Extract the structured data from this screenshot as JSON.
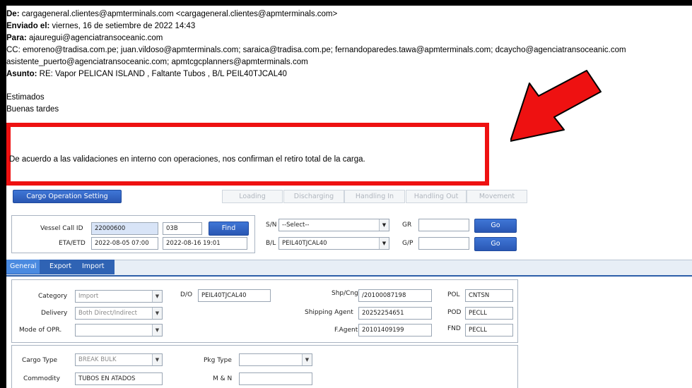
{
  "email": {
    "from_label": "De:",
    "from_value": " cargageneral.clientes@apmterminals.com <cargageneral.clientes@apmterminals.com>",
    "sent_label": "Enviado el:",
    "sent_value": " viernes, 16 de setiembre de 2022 14:43",
    "to_label": "Para:",
    "to_value": " ajauregui@agenciatransoceanic.com",
    "cc_label": "CC:",
    "cc_value": " emoreno@tradisa.com.pe; juan.vildoso@apmterminals.com; saraica@tradisa.com.pe; fernandoparedes.tawa@apmterminals.com; dcaycho@agenciatransoceanic.com",
    "cc_value2": "asistente_puerto@agenciatransoceanic.com; apmtcgcplanners@apmterminals.com",
    "subject_label": "Asunto:",
    "subject_value": " RE: Vapor PELICAN ISLAND , Faltante Tubos , B/L PEIL40TJCAL40",
    "greeting": "Estimados",
    "greeting2": "Buenas tardes",
    "body": "De acuerdo a las validaciones en interno con operaciones, nos confirman el retiro total de la carga."
  },
  "app": {
    "cargo_op_button": "Cargo Operation Setting",
    "loading": "Loading",
    "discharging": "Discharging",
    "handling_in": "Handling In",
    "handling_out": "Handling Out",
    "movement": "Movement",
    "vessel_call_id_label": "Vessel Call ID",
    "vessel_call_id": "22000600",
    "vessel_code": "03B",
    "find": "Find",
    "eta_etd_label": "ETA/ETD",
    "eta": "2022-08-05 07:00",
    "etd": "2022-08-16 19:01",
    "sn_label": "S/N",
    "sn_value": "--Select--",
    "bl_label": "B/L",
    "bl_value": "PEIL40TJCAL40",
    "gr_label": "GR",
    "gp_label": "G/P",
    "go": "Go",
    "tabs": [
      "General",
      "Export",
      "Import"
    ],
    "category_label": "Category",
    "category": "Import",
    "delivery_label": "Delivery",
    "delivery": "Both Direct/Indirect",
    "mode_label": "Mode of OPR.",
    "do_label": "D/O",
    "do_value": "PEIL40TJCAL40",
    "shp_label": "Shp/Cng",
    "shp_value": "/20100087198",
    "agent_label": "Shipping Agent",
    "agent_value": "20252254651",
    "fagent_label": "F.Agent",
    "fagent_value": "20101409199",
    "pol_label": "POL",
    "pol_value": "CNTSN",
    "pod_label": "POD",
    "pod_value": "PECLL",
    "fnd_label": "FND",
    "fnd_value": "PECLL",
    "cargo_type_label": "Cargo Type",
    "cargo_type": "BREAK BULK",
    "pkg_type_label": "Pkg Type",
    "commodity_label": "Commodity",
    "commodity": "TUBOS EN ATADOS",
    "mn_label": "M & N"
  }
}
